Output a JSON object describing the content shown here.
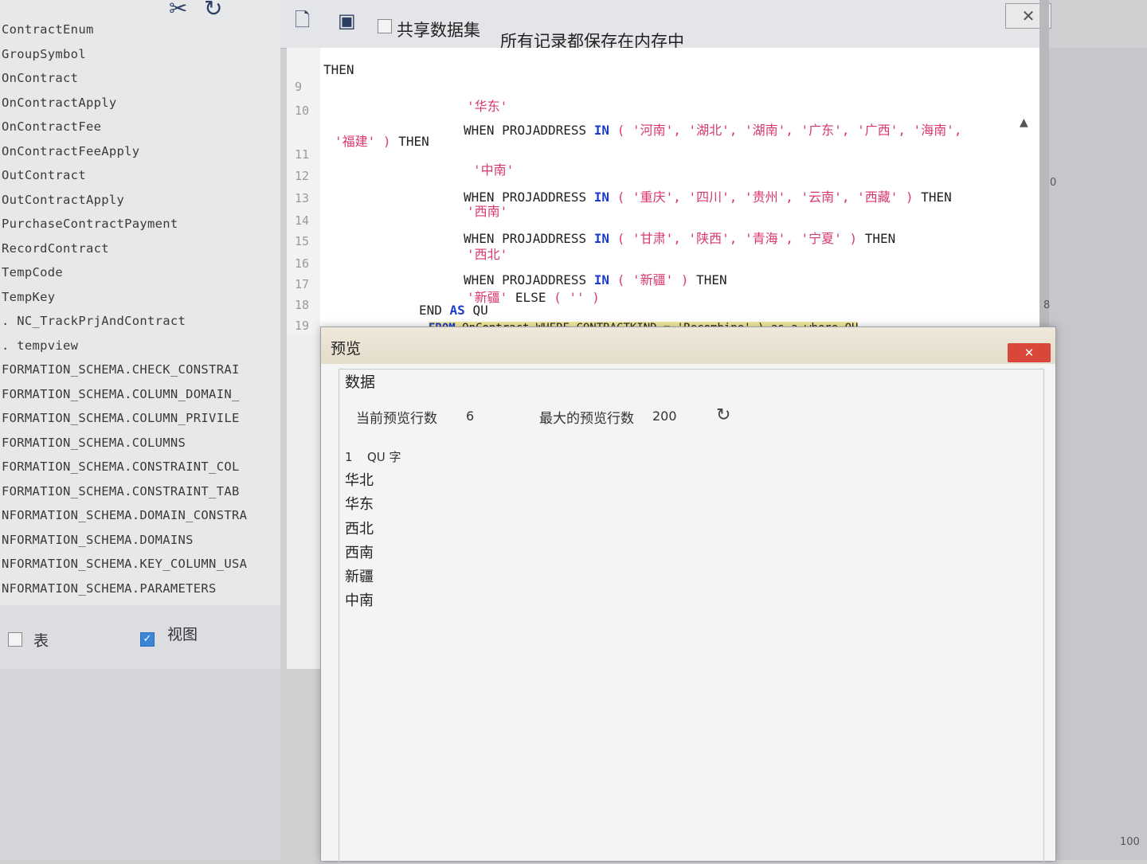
{
  "object_list": [
    "ContractEnum",
    "GroupSymbol",
    "OnContract",
    "OnContractApply",
    "OnContractFee",
    "OnContractFeeApply",
    "OutContract",
    "OutContractApply",
    "PurchaseContractPayment",
    "RecordContract",
    "TempCode",
    "TempKey",
    ". NC_TrackPrjAndContract",
    ". tempview",
    "FORMATION_SCHEMA.CHECK_CONSTRAI",
    "FORMATION_SCHEMA.COLUMN_DOMAIN_",
    "FORMATION_SCHEMA.COLUMN_PRIVILE",
    "FORMATION_SCHEMA.COLUMNS",
    "FORMATION_SCHEMA.CONSTRAINT_COL",
    "FORMATION_SCHEMA.CONSTRAINT_TAB",
    "NFORMATION_SCHEMA.DOMAIN_CONSTRA",
    "NFORMATION_SCHEMA.DOMAINS",
    "NFORMATION_SCHEMA.KEY_COLUMN_USA",
    "NFORMATION_SCHEMA.PARAMETERS"
  ],
  "filters": {
    "table_label": "表",
    "table_checked": false,
    "view_label": "视图",
    "view_checked": true
  },
  "toolbar": {
    "share_label": "共享数据集",
    "memory_label": "所有记录都保存在内存中"
  },
  "editor": {
    "line_numbers": [
      "9",
      "10",
      "11",
      "12",
      "13",
      "14",
      "15",
      "16",
      "17",
      "18",
      "19"
    ],
    "then": "THEN",
    "when": "WHEN",
    "field": "PROJADDRESS",
    "in": "IN",
    "else": "ELSE",
    "end": "END",
    "as": "AS",
    "alias": "QU",
    "from": "FROM",
    "r_huadong": "'华东'",
    "r_zhongnan": "'中南'",
    "r_xinan": "'西南'",
    "r_xibei": "'西北'",
    "r_xinjiang": "'新疆'",
    "zn_list": "( '河南', '湖北', '湖南', '广东', '广西', '海南',",
    "zn_tail": "'福建' )",
    "xn_list": "( '重庆', '四川', '贵州', '云南', '西藏' )",
    "xb_list": "( '甘肃', '陕西', '青海', '宁夏' )",
    "xj_list": "( '新疆' )",
    "else_val": "( '' )",
    "from_tail": "OnContract WHERE CONTRACTKIND = 'Recombine' ) as a where QU"
  },
  "side_values": {
    "top": "0",
    "mid": "8",
    "bottom": "100"
  },
  "preview": {
    "title": "预览",
    "data_heading": "数据",
    "current_rows_label": "当前预览行数",
    "current_rows_value": "6",
    "max_rows_label": "最大的预览行数",
    "max_rows_value": "200",
    "column_index": "1",
    "column_name": "QU 字",
    "rows": [
      "华北",
      "华东",
      "西北",
      "西南",
      "新疆",
      "中南"
    ]
  }
}
